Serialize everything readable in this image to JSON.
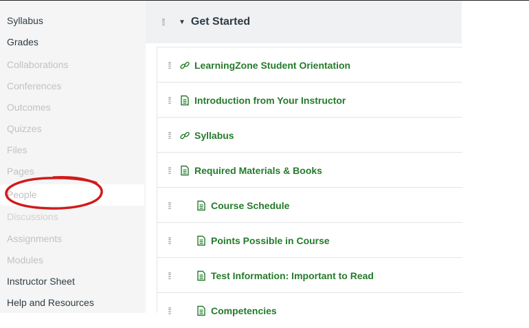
{
  "sidebar": {
    "items": [
      {
        "label": "Syllabus",
        "state": "enabled"
      },
      {
        "label": "Grades",
        "state": "enabled"
      },
      {
        "label": "Collaborations",
        "state": "disabled"
      },
      {
        "label": "Conferences",
        "state": "disabled"
      },
      {
        "label": "Outcomes",
        "state": "disabled"
      },
      {
        "label": "Quizzes",
        "state": "disabled"
      },
      {
        "label": "Files",
        "state": "disabled"
      },
      {
        "label": "Pages",
        "state": "disabled"
      },
      {
        "label": "People",
        "state": "selected-disabled"
      },
      {
        "label": "Discussions",
        "state": "disabled"
      },
      {
        "label": "Assignments",
        "state": "disabled"
      },
      {
        "label": "Modules",
        "state": "disabled"
      },
      {
        "label": "Instructor Sheet",
        "state": "enabled"
      },
      {
        "label": "Help and Resources",
        "state": "enabled"
      }
    ]
  },
  "annotation": {
    "shape": "red-ellipse",
    "target": "People",
    "color": "#d11a1a"
  },
  "module": {
    "title": "Get Started",
    "items": [
      {
        "title": "LearningZone Student Orientation",
        "icon": "link-icon",
        "indent": false
      },
      {
        "title": "Introduction from Your Instructor",
        "icon": "document-icon",
        "indent": false
      },
      {
        "title": "Syllabus",
        "icon": "link-icon",
        "indent": false
      },
      {
        "title": "Required Materials & Books",
        "icon": "document-icon",
        "indent": false
      },
      {
        "title": "Course Schedule",
        "icon": "document-icon",
        "indent": true
      },
      {
        "title": "Points Possible in Course",
        "icon": "document-icon",
        "indent": true
      },
      {
        "title": "Test Information: Important to Read",
        "icon": "document-icon",
        "indent": true
      },
      {
        "title": "Competencies",
        "icon": "document-icon",
        "indent": true
      }
    ]
  },
  "colors": {
    "item_title": "#237b2a",
    "sidebar_enabled": "#2d3b45",
    "sidebar_disabled": "#c2c2c2",
    "annotation": "#d11a1a"
  }
}
